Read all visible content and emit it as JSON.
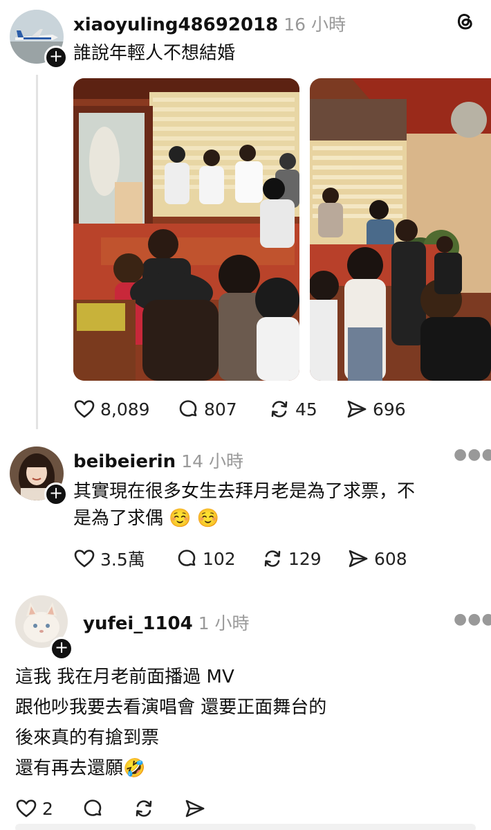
{
  "post": {
    "username": "xiaoyuling48692018",
    "time": "16 小時",
    "text": "誰說年輕人不想結婚",
    "actions": {
      "likes": "8,089",
      "comments": "807",
      "reposts": "45",
      "shares": "696"
    },
    "brand_icon": "threads-logo-icon"
  },
  "replies": [
    {
      "username": "beibeierin",
      "time": "14 小時",
      "text": "其實現在很多女生去拜月老是為了求票，不\n是為了求偶 ☺️ ☺️",
      "actions": {
        "likes": "3.5萬",
        "comments": "102",
        "reposts": "129",
        "shares": "608"
      }
    },
    {
      "username": "yufei_1104",
      "time": "1 小時",
      "text": "這我 我在月老前面播過 MV\n跟他吵我要去看演唱會 還要正面舞台的\n後來真的有搶到票\n還有再去還願🤣",
      "actions": {
        "likes": "2",
        "comments": "",
        "reposts": "",
        "shares": ""
      }
    }
  ],
  "colors": {
    "text": "#111111",
    "muted": "#999999",
    "line": "#e3e3e3"
  }
}
